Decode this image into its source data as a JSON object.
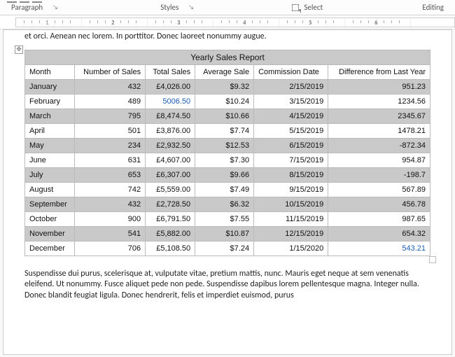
{
  "ribbon": {
    "paragraph": "Paragraph",
    "styles": "Styles",
    "editing": "Editing",
    "select": "Select"
  },
  "ruler_numbers": [
    "1",
    "2",
    "3",
    "4",
    "5",
    "6"
  ],
  "intro_text": "et orci. Aenean nec lorem. In porttitor. Donec laoreet nonummy augue.",
  "table": {
    "title": "Yearly Sales Report",
    "headers": [
      "Month",
      "Number of Sales",
      "Total Sales",
      "Average Sale",
      "Commission Date",
      "Difference from Last Year"
    ],
    "rows": [
      {
        "month": "January",
        "num_sales": "432",
        "total": "£4,026.00",
        "avg": "$9.32",
        "date": "2/15/2019",
        "diff": "951.23",
        "total_link": false,
        "diff_link": false
      },
      {
        "month": "February",
        "num_sales": "489",
        "total": "5006.50",
        "avg": "$10.24",
        "date": "3/15/2019",
        "diff": "1234.56",
        "total_link": true,
        "diff_link": false
      },
      {
        "month": "March",
        "num_sales": "795",
        "total": "£8,474.50",
        "avg": "$10.66",
        "date": "4/15/2019",
        "diff": "2345.67",
        "total_link": false,
        "diff_link": false
      },
      {
        "month": "April",
        "num_sales": "501",
        "total": "£3,876.00",
        "avg": "$7.74",
        "date": "5/15/2019",
        "diff": "1478.21",
        "total_link": false,
        "diff_link": false
      },
      {
        "month": "May",
        "num_sales": "234",
        "total": "£2,932.50",
        "avg": "$12.53",
        "date": "6/15/2019",
        "diff": "-872.34",
        "total_link": false,
        "diff_link": false
      },
      {
        "month": "June",
        "num_sales": "631",
        "total": "£4,607.00",
        "avg": "$7.30",
        "date": "7/15/2019",
        "diff": "954.87",
        "total_link": false,
        "diff_link": false
      },
      {
        "month": "July",
        "num_sales": "653",
        "total": "£6,307.00",
        "avg": "$9.66",
        "date": "8/15/2019",
        "diff": "-198.7",
        "total_link": false,
        "diff_link": false
      },
      {
        "month": "August",
        "num_sales": "742",
        "total": "£5,559.00",
        "avg": "$7.49",
        "date": "9/15/2019",
        "diff": "567.89",
        "total_link": false,
        "diff_link": false
      },
      {
        "month": "September",
        "num_sales": "432",
        "total": "£2,728.50",
        "avg": "$6.32",
        "date": "10/15/2019",
        "diff": "456.78",
        "total_link": false,
        "diff_link": false
      },
      {
        "month": "October",
        "num_sales": "900",
        "total": "£6,791.50",
        "avg": "$7.55",
        "date": "11/15/2019",
        "diff": "987.65",
        "total_link": false,
        "diff_link": false
      },
      {
        "month": "November",
        "num_sales": "541",
        "total": "£5,882.00",
        "avg": "$10.87",
        "date": "12/15/2019",
        "diff": "654.32",
        "total_link": false,
        "diff_link": false
      },
      {
        "month": "December",
        "num_sales": "706",
        "total": "£5,108.50",
        "avg": "$7.24",
        "date": "1/15/2020",
        "diff": "543.21",
        "total_link": false,
        "diff_link": true
      }
    ]
  },
  "outro_text": "Suspendisse dui purus, scelerisque at, vulputate vitae, pretium mattis, nunc. Mauris eget neque at sem venenatis eleifend. Ut nonummy. Fusce aliquet pede non pede. Suspendisse dapibus lorem pellentesque magna. Integer nulla. Donec blandit feugiat ligula. Donec hendrerit, felis et imperdiet euismod, purus",
  "chart_data": {
    "type": "table",
    "title": "Yearly Sales Report",
    "columns": [
      "Month",
      "Number of Sales",
      "Total Sales",
      "Average Sale",
      "Commission Date",
      "Difference from Last Year"
    ],
    "rows": [
      [
        "January",
        432,
        "£4,026.00",
        "$9.32",
        "2/15/2019",
        951.23
      ],
      [
        "February",
        489,
        "5006.50",
        "$10.24",
        "3/15/2019",
        1234.56
      ],
      [
        "March",
        795,
        "£8,474.50",
        "$10.66",
        "4/15/2019",
        2345.67
      ],
      [
        "April",
        501,
        "£3,876.00",
        "$7.74",
        "5/15/2019",
        1478.21
      ],
      [
        "May",
        234,
        "£2,932.50",
        "$12.53",
        "6/15/2019",
        -872.34
      ],
      [
        "June",
        631,
        "£4,607.00",
        "$7.30",
        "7/15/2019",
        954.87
      ],
      [
        "July",
        653,
        "£6,307.00",
        "$9.66",
        "8/15/2019",
        -198.7
      ],
      [
        "August",
        742,
        "£5,559.00",
        "$7.49",
        "9/15/2019",
        567.89
      ],
      [
        "September",
        432,
        "£2,728.50",
        "$6.32",
        "10/15/2019",
        456.78
      ],
      [
        "October",
        900,
        "£6,791.50",
        "$7.55",
        "11/15/2019",
        987.65
      ],
      [
        "November",
        541,
        "£5,882.00",
        "$10.87",
        "12/15/2019",
        654.32
      ],
      [
        "December",
        706,
        "£5,108.50",
        "$7.24",
        "1/15/2020",
        543.21
      ]
    ]
  }
}
